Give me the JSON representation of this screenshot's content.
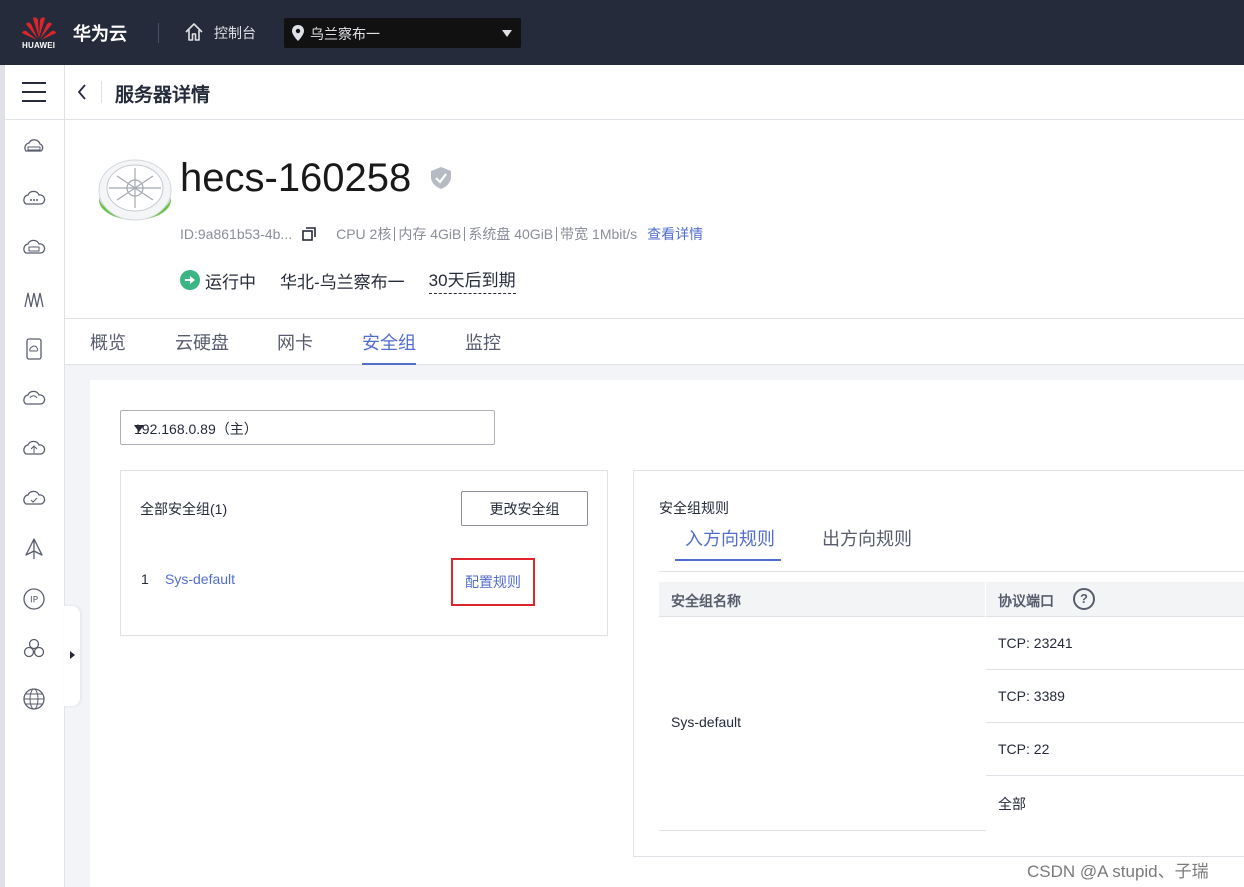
{
  "topbar": {
    "logo_text": "HUAWEI",
    "brand": "华为云",
    "console_label": "控制台",
    "region": "乌兰察布一",
    "icons": [
      "huawei-logo-icon",
      "home-icon",
      "location-pin-icon",
      "caret-down-icon"
    ]
  },
  "leftnav": {
    "icons": [
      "menu-icon",
      "cloud-server-icon",
      "cloud-icon",
      "storage-icon",
      "network-icon",
      "database-icon",
      "cloud-outline-icon",
      "cloud-upload-icon",
      "cloud-check-icon",
      "cdn-icon",
      "ip-icon",
      "cluster-icon",
      "globe-icon"
    ]
  },
  "header": {
    "title": "服务器详情"
  },
  "server": {
    "name": "hecs-160258",
    "id": "ID:9a861b53-4b...",
    "cpu": "CPU 2核",
    "memory": "内存 4GiB",
    "disk": "系统盘 40GiB",
    "bandwidth": "带宽 1Mbit/s",
    "details_link": "查看详情",
    "status": "运行中",
    "region": "华北-乌兰察布一",
    "expire": "30天后到期"
  },
  "tabs": [
    {
      "label": "概览",
      "active": false
    },
    {
      "label": "云硬盘",
      "active": false
    },
    {
      "label": "网卡",
      "active": false
    },
    {
      "label": "安全组",
      "active": true
    },
    {
      "label": "监控",
      "active": false
    }
  ],
  "security": {
    "nic_select": "192.168.0.89（主）",
    "all_groups_title": "全部安全组(1)",
    "change_button": "更改安全组",
    "groups": [
      {
        "index": "1",
        "name": "Sys-default",
        "action": "配置规则"
      }
    ],
    "rules_title": "安全组规则",
    "rule_tabs": [
      {
        "label": "入方向规则",
        "active": true
      },
      {
        "label": "出方向规则",
        "active": false
      }
    ],
    "columns": [
      "安全组名称",
      "协议端口"
    ],
    "rule_group_name": "Sys-default",
    "ports": [
      "TCP: 23241",
      "TCP: 3389",
      "TCP: 22",
      "全部"
    ]
  },
  "watermark": "CSDN @A stupid、子瑞",
  "colors": {
    "topbar_bg": "#252b3a",
    "accent": "#526ecc",
    "running": "#3bb584",
    "highlight_box": "#e0252a"
  }
}
